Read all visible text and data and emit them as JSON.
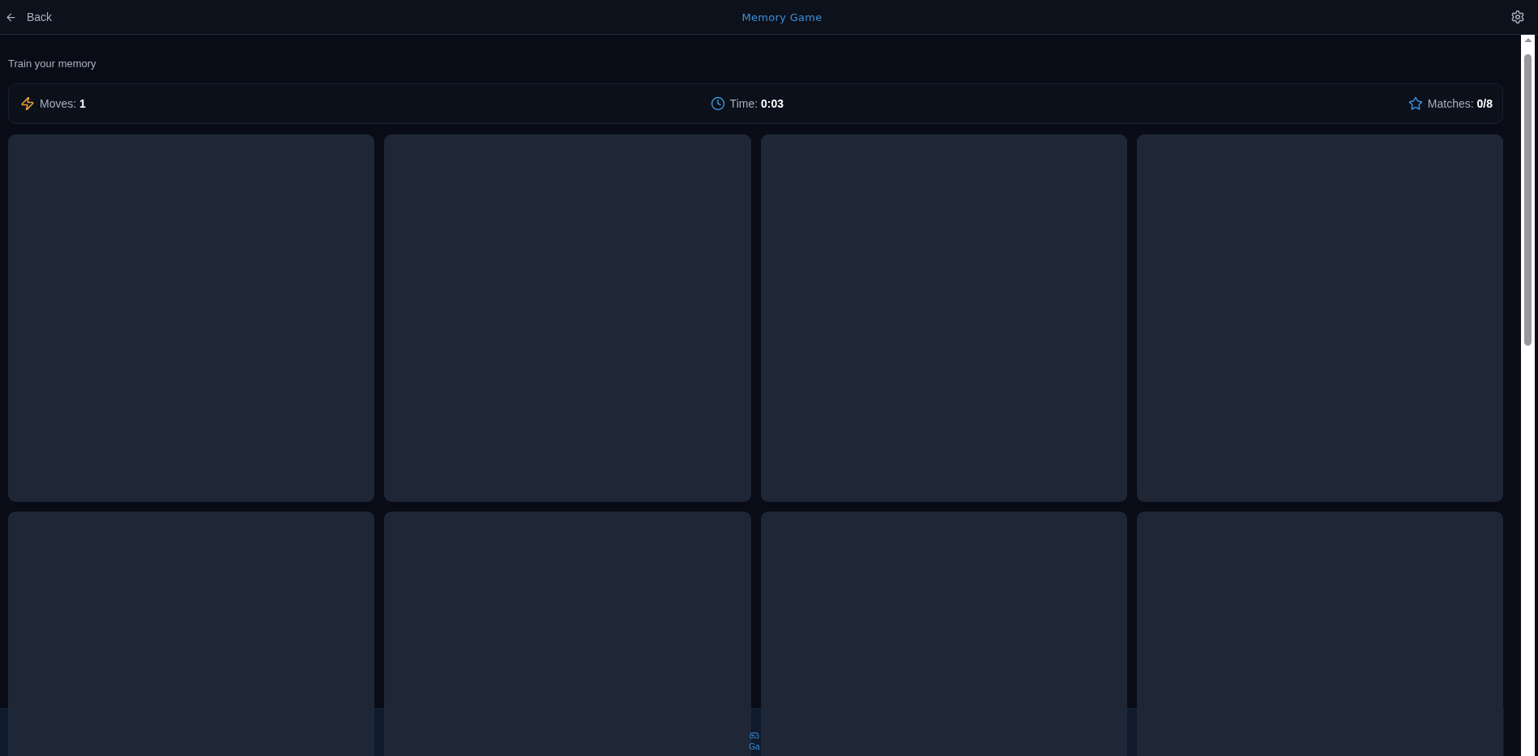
{
  "header": {
    "back_label": "Back",
    "title": "Memory Game"
  },
  "subtitle": "Train your memory",
  "stats": [
    {
      "kind": "moves",
      "label": "Moves:",
      "value": "1"
    },
    {
      "kind": "time",
      "label": "Time:",
      "value": "0:03"
    },
    {
      "kind": "matches",
      "label": "Matches:",
      "value": "0/8"
    }
  ],
  "cards": [
    {
      "face_up": false
    },
    {
      "face_up": false
    },
    {
      "face_up": false
    },
    {
      "face_up": false
    },
    {
      "face_up": false
    },
    {
      "face_up": false
    },
    {
      "face_up": false
    },
    {
      "face_up": false
    }
  ],
  "bottom_nav": {
    "label": "Ga"
  }
}
